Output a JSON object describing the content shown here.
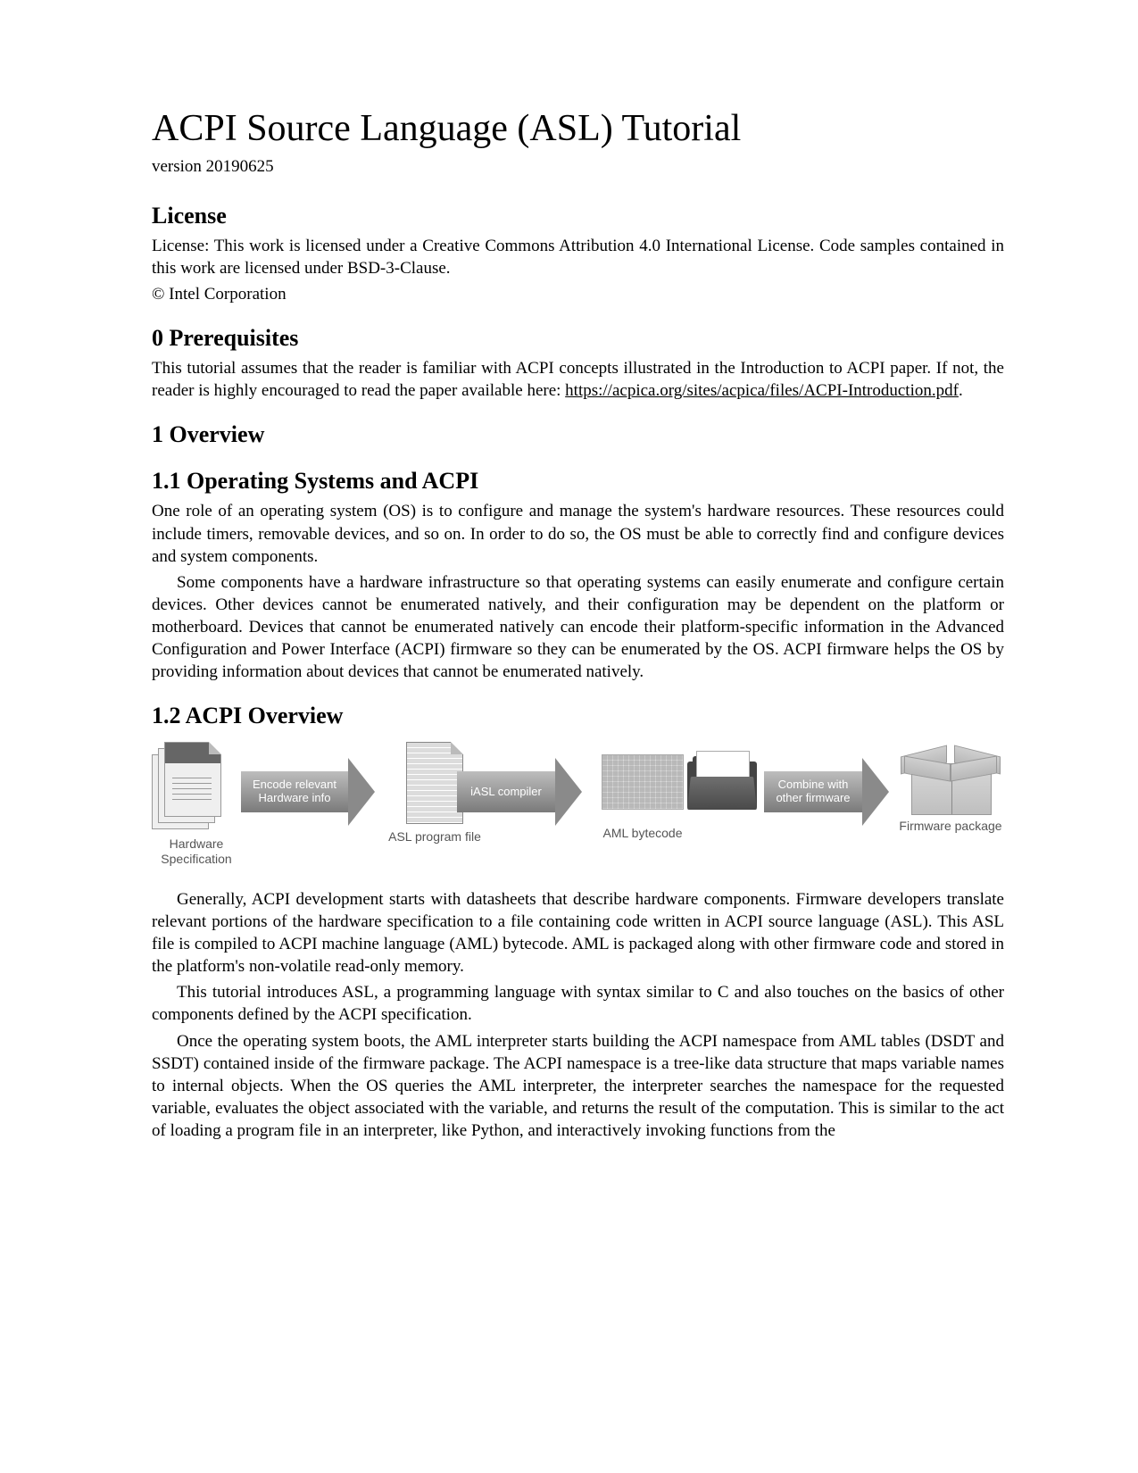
{
  "title": "ACPI Source Language (ASL) Tutorial",
  "version": "version 20190625",
  "sections": {
    "license": {
      "heading": "License",
      "p1": "License: This work is licensed under a Creative Commons Attribution 4.0 International License.  Code samples contained in this work are licensed under BSD-3-Clause.",
      "p2": "© Intel Corporation"
    },
    "prereq": {
      "heading": "0 Prerequisites",
      "p1a": "This tutorial assumes that the reader is familiar with ACPI concepts illustrated in the Introduction to ACPI paper. If not, the reader is highly encouraged to read the paper available here: ",
      "link": "https://acpica.org/sites/acpica/files/ACPI-Introduction.pdf",
      "p1b": "."
    },
    "overview": {
      "heading": "1  Overview"
    },
    "os_acpi": {
      "heading": "1.1  Operating Systems and ACPI",
      "p1": "One role of an operating system (OS) is to configure and manage the system's hardware resources. These resources could include timers, removable devices, and so on. In order to do so, the OS must be able to correctly find and configure devices and system components.",
      "p2": "Some components have a hardware infrastructure so that operating systems can easily enumerate and configure certain devices. Other devices cannot be enumerated natively, and their configuration may be dependent on the platform or motherboard. Devices that cannot be enumerated natively can encode their platform-specific information in the Advanced Configuration and Power Interface (ACPI) firmware so they can be enumerated by the OS. ACPI firmware helps the OS by providing information about devices that cannot be enumerated natively."
    },
    "acpi_overview": {
      "heading": "1.2  ACPI Overview",
      "diagram": {
        "stage1": "Hardware Specification",
        "arrow1_line1": "Encode relevant",
        "arrow1_line2": "Hardware info",
        "stage2": "ASL program file",
        "arrow2": "iASL compiler",
        "stage3": "AML bytecode",
        "arrow3_line1": "Combine with",
        "arrow3_line2": "other firmware",
        "stage4": "Firmware package"
      },
      "p1": "Generally, ACPI development starts with datasheets that describe hardware components. Firmware developers translate relevant portions of the hardware specification to a file containing code written in ACPI source language (ASL). This ASL file is compiled to ACPI machine language (AML) bytecode. AML is packaged along with other firmware code and stored in the platform's non-volatile read-only memory.",
      "p2": "This tutorial introduces ASL, a programming language with syntax similar to C and also touches on the basics of other components defined by the ACPI specification.",
      "p3": "Once the operating system boots, the AML interpreter starts building the ACPI namespace from AML tables (DSDT and SSDT) contained inside of the firmware package. The ACPI namespace is a tree-like data structure that maps variable names to internal objects. When the OS queries the AML interpreter, the interpreter searches the namespace for the requested variable, evaluates the object associated with the variable, and returns the result of the computation. This is similar to the act of loading a program file in an interpreter, like Python, and interactively invoking functions from the"
    }
  }
}
